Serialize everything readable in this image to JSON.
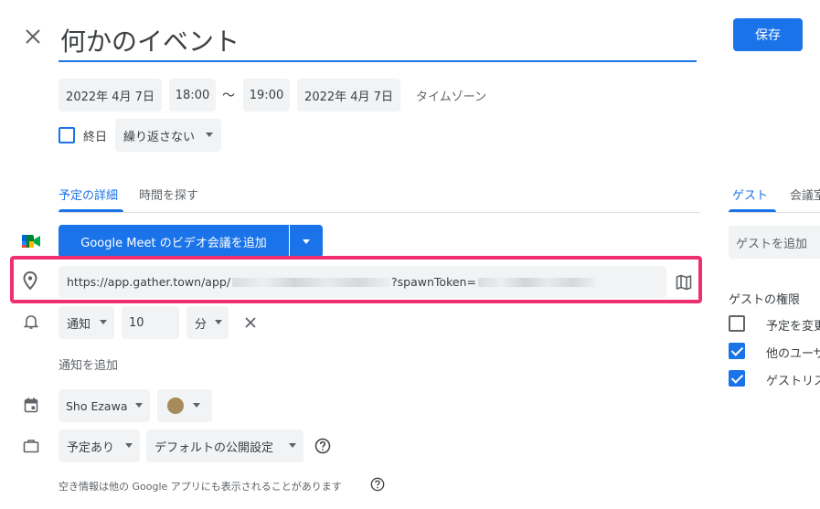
{
  "header": {
    "close_label": "×",
    "title": "何かのイベント",
    "save_label": "保存"
  },
  "datetime": {
    "start_date": "2022年 4月 7日",
    "start_time": "18:00",
    "separator": "〜",
    "end_time": "19:00",
    "end_date": "2022年 4月 7日",
    "timezone_label": "タイムゾーン"
  },
  "options": {
    "all_day_label": "終日",
    "all_day_checked": false,
    "repeat_value": "繰り返さない"
  },
  "tabs": [
    {
      "label": "予定の詳細",
      "active": true
    },
    {
      "label": "時間を探す",
      "active": false
    }
  ],
  "meet": {
    "button_label": "Google Meet のビデオ会議を追加"
  },
  "location": {
    "url_prefix": "https://app.gather.town/app/",
    "url_middle": "?spawnToken="
  },
  "notification": {
    "type": "通知",
    "amount": "10",
    "unit": "分",
    "add_label": "通知を追加"
  },
  "calendar": {
    "owner": "Sho Ezawa",
    "color": "#a68b5b"
  },
  "availability": {
    "status": "予定あり",
    "visibility": "デフォルトの公開設定",
    "note": "空き情報は他の Google アプリにも表示されることがあります"
  },
  "guests_panel": {
    "tabs": [
      {
        "label": "ゲスト",
        "active": true
      },
      {
        "label": "会議室",
        "active": false
      }
    ],
    "add_placeholder": "ゲストを追加",
    "permissions_title": "ゲストの権限",
    "permissions": [
      {
        "label": "予定を変更する",
        "checked": false
      },
      {
        "label": "他のユーザーを招待する",
        "checked": true
      },
      {
        "label": "ゲストリストを表示する",
        "checked": true
      }
    ]
  },
  "colors": {
    "accent": "#1a73e8",
    "highlight": "#f0306e"
  }
}
